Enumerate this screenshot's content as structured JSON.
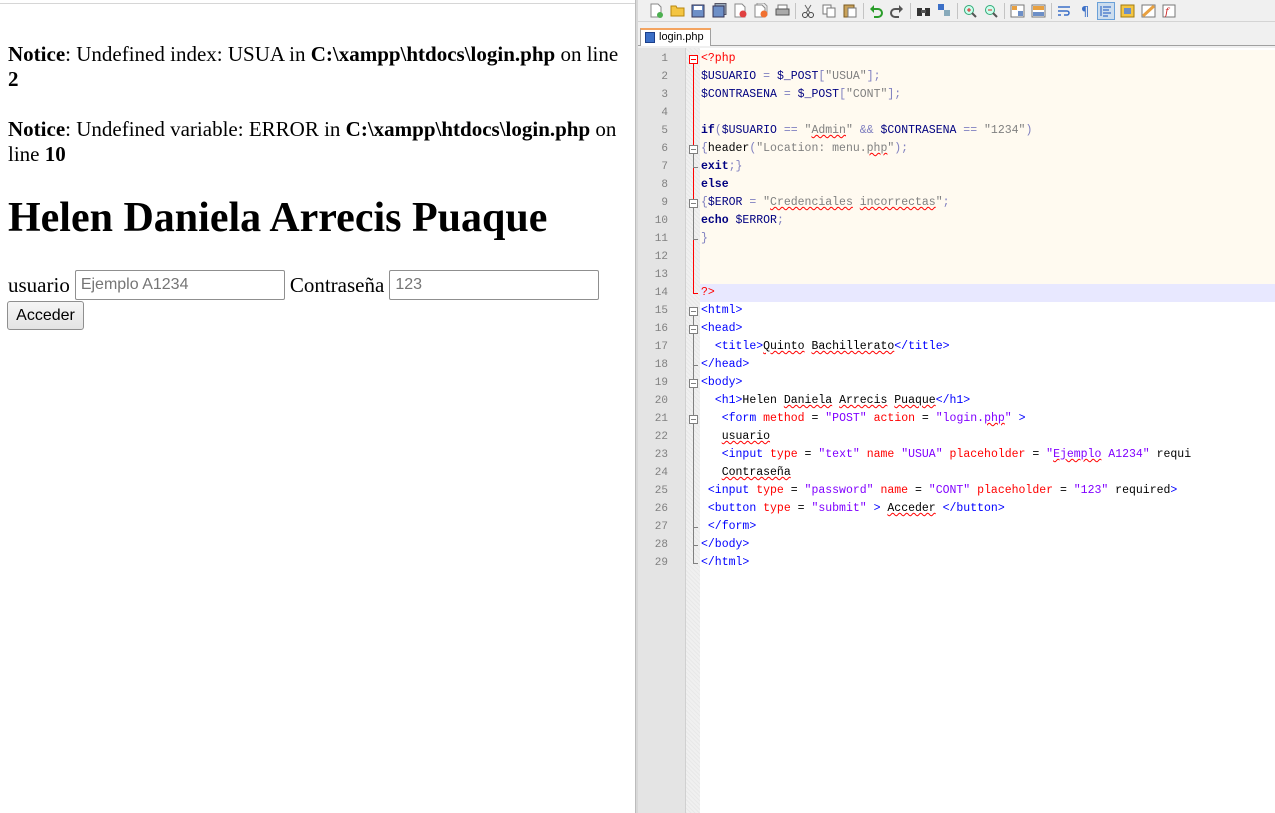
{
  "browser": {
    "notices": [
      {
        "label": "Notice",
        "message": ": Undefined index: USUA in ",
        "path": "C:\\xampp\\htdocs\\login.php",
        "on_line": " on line ",
        "line": "2"
      },
      {
        "label": "Notice",
        "message": ": Undefined variable: ERROR in ",
        "path": "C:\\xampp\\htdocs\\login.php",
        "on_line": " on line ",
        "line": "10"
      }
    ],
    "heading": "Helen Daniela Arrecis Puaque",
    "form": {
      "user_label": "usuario",
      "user_placeholder": "Ejemplo A1234",
      "pass_label": "Contraseña",
      "pass_placeholder": "123",
      "submit_label": "Acceder"
    }
  },
  "editor": {
    "tab_name": "login.php",
    "toolbar_icons": [
      "new-file-icon",
      "open-file-icon",
      "save-icon",
      "save-all-icon",
      "close-icon",
      "close-all-icon",
      "print-icon",
      "cut-icon",
      "copy-icon",
      "paste-icon",
      "undo-icon",
      "redo-icon",
      "find-icon",
      "replace-icon",
      "zoom-in-icon",
      "zoom-out-icon",
      "sync-vertical-icon",
      "sync-horizontal-icon",
      "word-wrap-icon",
      "show-all-chars-icon",
      "indent-guide-icon",
      "user-language-icon",
      "document-map-icon",
      "function-list-icon"
    ],
    "line_numbers": [
      "1",
      "2",
      "3",
      "4",
      "5",
      "6",
      "7",
      "8",
      "9",
      "10",
      "11",
      "12",
      "13",
      "14",
      "15",
      "16",
      "17",
      "18",
      "19",
      "20",
      "21",
      "22",
      "23",
      "24",
      "25",
      "26",
      "27",
      "28",
      "29"
    ],
    "lines": [
      [
        {
          "c": "phptag",
          "t": "<?php"
        }
      ],
      [
        {
          "c": "var",
          "t": "$USUARIO"
        },
        {
          "c": "op",
          "t": " = "
        },
        {
          "c": "var",
          "t": "$_POST"
        },
        {
          "c": "op",
          "t": "["
        },
        {
          "c": "str",
          "t": "\"USUA\""
        },
        {
          "c": "op",
          "t": "];"
        }
      ],
      [
        {
          "c": "var",
          "t": "$CONTRASENA"
        },
        {
          "c": "op",
          "t": " = "
        },
        {
          "c": "var",
          "t": "$_POST"
        },
        {
          "c": "op",
          "t": "["
        },
        {
          "c": "str",
          "t": "\"CONT\""
        },
        {
          "c": "op",
          "t": "];"
        }
      ],
      [],
      [
        {
          "c": "kw",
          "t": "if"
        },
        {
          "c": "op",
          "t": "("
        },
        {
          "c": "var",
          "t": "$USUARIO"
        },
        {
          "c": "op",
          "t": " == "
        },
        {
          "c": "str",
          "t": "\""
        },
        {
          "c": "str sq",
          "t": "Admin"
        },
        {
          "c": "str",
          "t": "\""
        },
        {
          "c": "op",
          "t": " && "
        },
        {
          "c": "var",
          "t": "$CONTRASENA"
        },
        {
          "c": "op",
          "t": " == "
        },
        {
          "c": "str",
          "t": "\"1234\""
        },
        {
          "c": "op",
          "t": ")"
        }
      ],
      [
        {
          "c": "op",
          "t": "{"
        },
        {
          "c": "fn",
          "t": "header"
        },
        {
          "c": "op",
          "t": "("
        },
        {
          "c": "str",
          "t": "\"Location: menu."
        },
        {
          "c": "str sq",
          "t": "php"
        },
        {
          "c": "str",
          "t": "\""
        },
        {
          "c": "op",
          "t": ");"
        }
      ],
      [
        {
          "c": "kw",
          "t": "exit"
        },
        {
          "c": "op",
          "t": ";}"
        }
      ],
      [
        {
          "c": "kw",
          "t": "else"
        }
      ],
      [
        {
          "c": "op",
          "t": "{"
        },
        {
          "c": "var",
          "t": "$EROR"
        },
        {
          "c": "op",
          "t": " = "
        },
        {
          "c": "str",
          "t": "\""
        },
        {
          "c": "str sq",
          "t": "Credenciales"
        },
        {
          "c": "str",
          "t": " "
        },
        {
          "c": "str sq",
          "t": "incorrectas"
        },
        {
          "c": "str",
          "t": "\""
        },
        {
          "c": "op",
          "t": ";"
        }
      ],
      [
        {
          "c": "kw",
          "t": "echo"
        },
        {
          "c": "op",
          "t": " "
        },
        {
          "c": "var",
          "t": "$ERROR"
        },
        {
          "c": "op",
          "t": ";"
        }
      ],
      [
        {
          "c": "op",
          "t": "}"
        }
      ],
      [],
      [],
      [
        {
          "c": "phptag",
          "t": "?>"
        }
      ],
      [
        {
          "c": "tag",
          "t": "<html>"
        }
      ],
      [
        {
          "c": "tag",
          "t": "<head>"
        }
      ],
      [
        {
          "c": "txt",
          "t": "  "
        },
        {
          "c": "tag",
          "t": "<title>"
        },
        {
          "c": "txt sq",
          "t": "Quinto"
        },
        {
          "c": "txt",
          "t": " "
        },
        {
          "c": "txt sq",
          "t": "Bachillerato"
        },
        {
          "c": "tag",
          "t": "</title>"
        }
      ],
      [
        {
          "c": "tag",
          "t": "</head>"
        }
      ],
      [
        {
          "c": "tag",
          "t": "<body>"
        }
      ],
      [
        {
          "c": "txt",
          "t": "  "
        },
        {
          "c": "tag",
          "t": "<h1>"
        },
        {
          "c": "txt",
          "t": "Helen "
        },
        {
          "c": "txt sq",
          "t": "Daniela"
        },
        {
          "c": "txt",
          "t": " "
        },
        {
          "c": "txt sq",
          "t": "Arrecis"
        },
        {
          "c": "txt",
          "t": " "
        },
        {
          "c": "txt sq",
          "t": "Puaque"
        },
        {
          "c": "tag",
          "t": "</h1>"
        }
      ],
      [
        {
          "c": "txt",
          "t": "   "
        },
        {
          "c": "tag",
          "t": "<form "
        },
        {
          "c": "attr",
          "t": "method"
        },
        {
          "c": "txt",
          "t": " = "
        },
        {
          "c": "aval",
          "t": "\"POST\""
        },
        {
          "c": "txt",
          "t": " "
        },
        {
          "c": "attr",
          "t": "action"
        },
        {
          "c": "txt",
          "t": " = "
        },
        {
          "c": "aval",
          "t": "\"login."
        },
        {
          "c": "aval sq",
          "t": "php"
        },
        {
          "c": "aval",
          "t": "\""
        },
        {
          "c": "tag",
          "t": " >"
        }
      ],
      [
        {
          "c": "txt",
          "t": "   "
        },
        {
          "c": "txt sq",
          "t": "usuario"
        }
      ],
      [
        {
          "c": "txt",
          "t": "   "
        },
        {
          "c": "tag",
          "t": "<input "
        },
        {
          "c": "attr",
          "t": "type"
        },
        {
          "c": "txt",
          "t": " = "
        },
        {
          "c": "aval",
          "t": "\"text\""
        },
        {
          "c": "txt",
          "t": " "
        },
        {
          "c": "attr",
          "t": "name"
        },
        {
          "c": "txt",
          "t": " "
        },
        {
          "c": "aval",
          "t": "\"USUA\""
        },
        {
          "c": "txt",
          "t": " "
        },
        {
          "c": "attr",
          "t": "placeholder"
        },
        {
          "c": "txt",
          "t": " = "
        },
        {
          "c": "aval",
          "t": "\""
        },
        {
          "c": "aval sq",
          "t": "Ejemplo"
        },
        {
          "c": "aval",
          "t": " A1234\""
        },
        {
          "c": "txt",
          "t": " requi"
        }
      ],
      [
        {
          "c": "txt",
          "t": "   "
        },
        {
          "c": "txt sq",
          "t": "Contraseña"
        }
      ],
      [
        {
          "c": "txt",
          "t": " "
        },
        {
          "c": "tag",
          "t": "<input "
        },
        {
          "c": "attr",
          "t": "type"
        },
        {
          "c": "txt",
          "t": " = "
        },
        {
          "c": "aval",
          "t": "\"password\""
        },
        {
          "c": "txt",
          "t": " "
        },
        {
          "c": "attr",
          "t": "name"
        },
        {
          "c": "txt",
          "t": " = "
        },
        {
          "c": "aval",
          "t": "\"CONT\""
        },
        {
          "c": "txt",
          "t": " "
        },
        {
          "c": "attr",
          "t": "placeholder"
        },
        {
          "c": "txt",
          "t": " = "
        },
        {
          "c": "aval",
          "t": "\"123\""
        },
        {
          "c": "txt",
          "t": " required"
        },
        {
          "c": "tag",
          "t": ">"
        }
      ],
      [
        {
          "c": "txt",
          "t": " "
        },
        {
          "c": "tag",
          "t": "<button "
        },
        {
          "c": "attr",
          "t": "type"
        },
        {
          "c": "txt",
          "t": " = "
        },
        {
          "c": "aval",
          "t": "\"submit\""
        },
        {
          "c": "tag",
          "t": " > "
        },
        {
          "c": "txt sq",
          "t": "Acceder"
        },
        {
          "c": "tag",
          "t": " </button>"
        }
      ],
      [
        {
          "c": "txt",
          "t": " "
        },
        {
          "c": "tag",
          "t": "</form>"
        }
      ],
      [
        {
          "c": "tag",
          "t": "</body>"
        }
      ],
      [
        {
          "c": "tag",
          "t": "</html>"
        }
      ]
    ]
  }
}
